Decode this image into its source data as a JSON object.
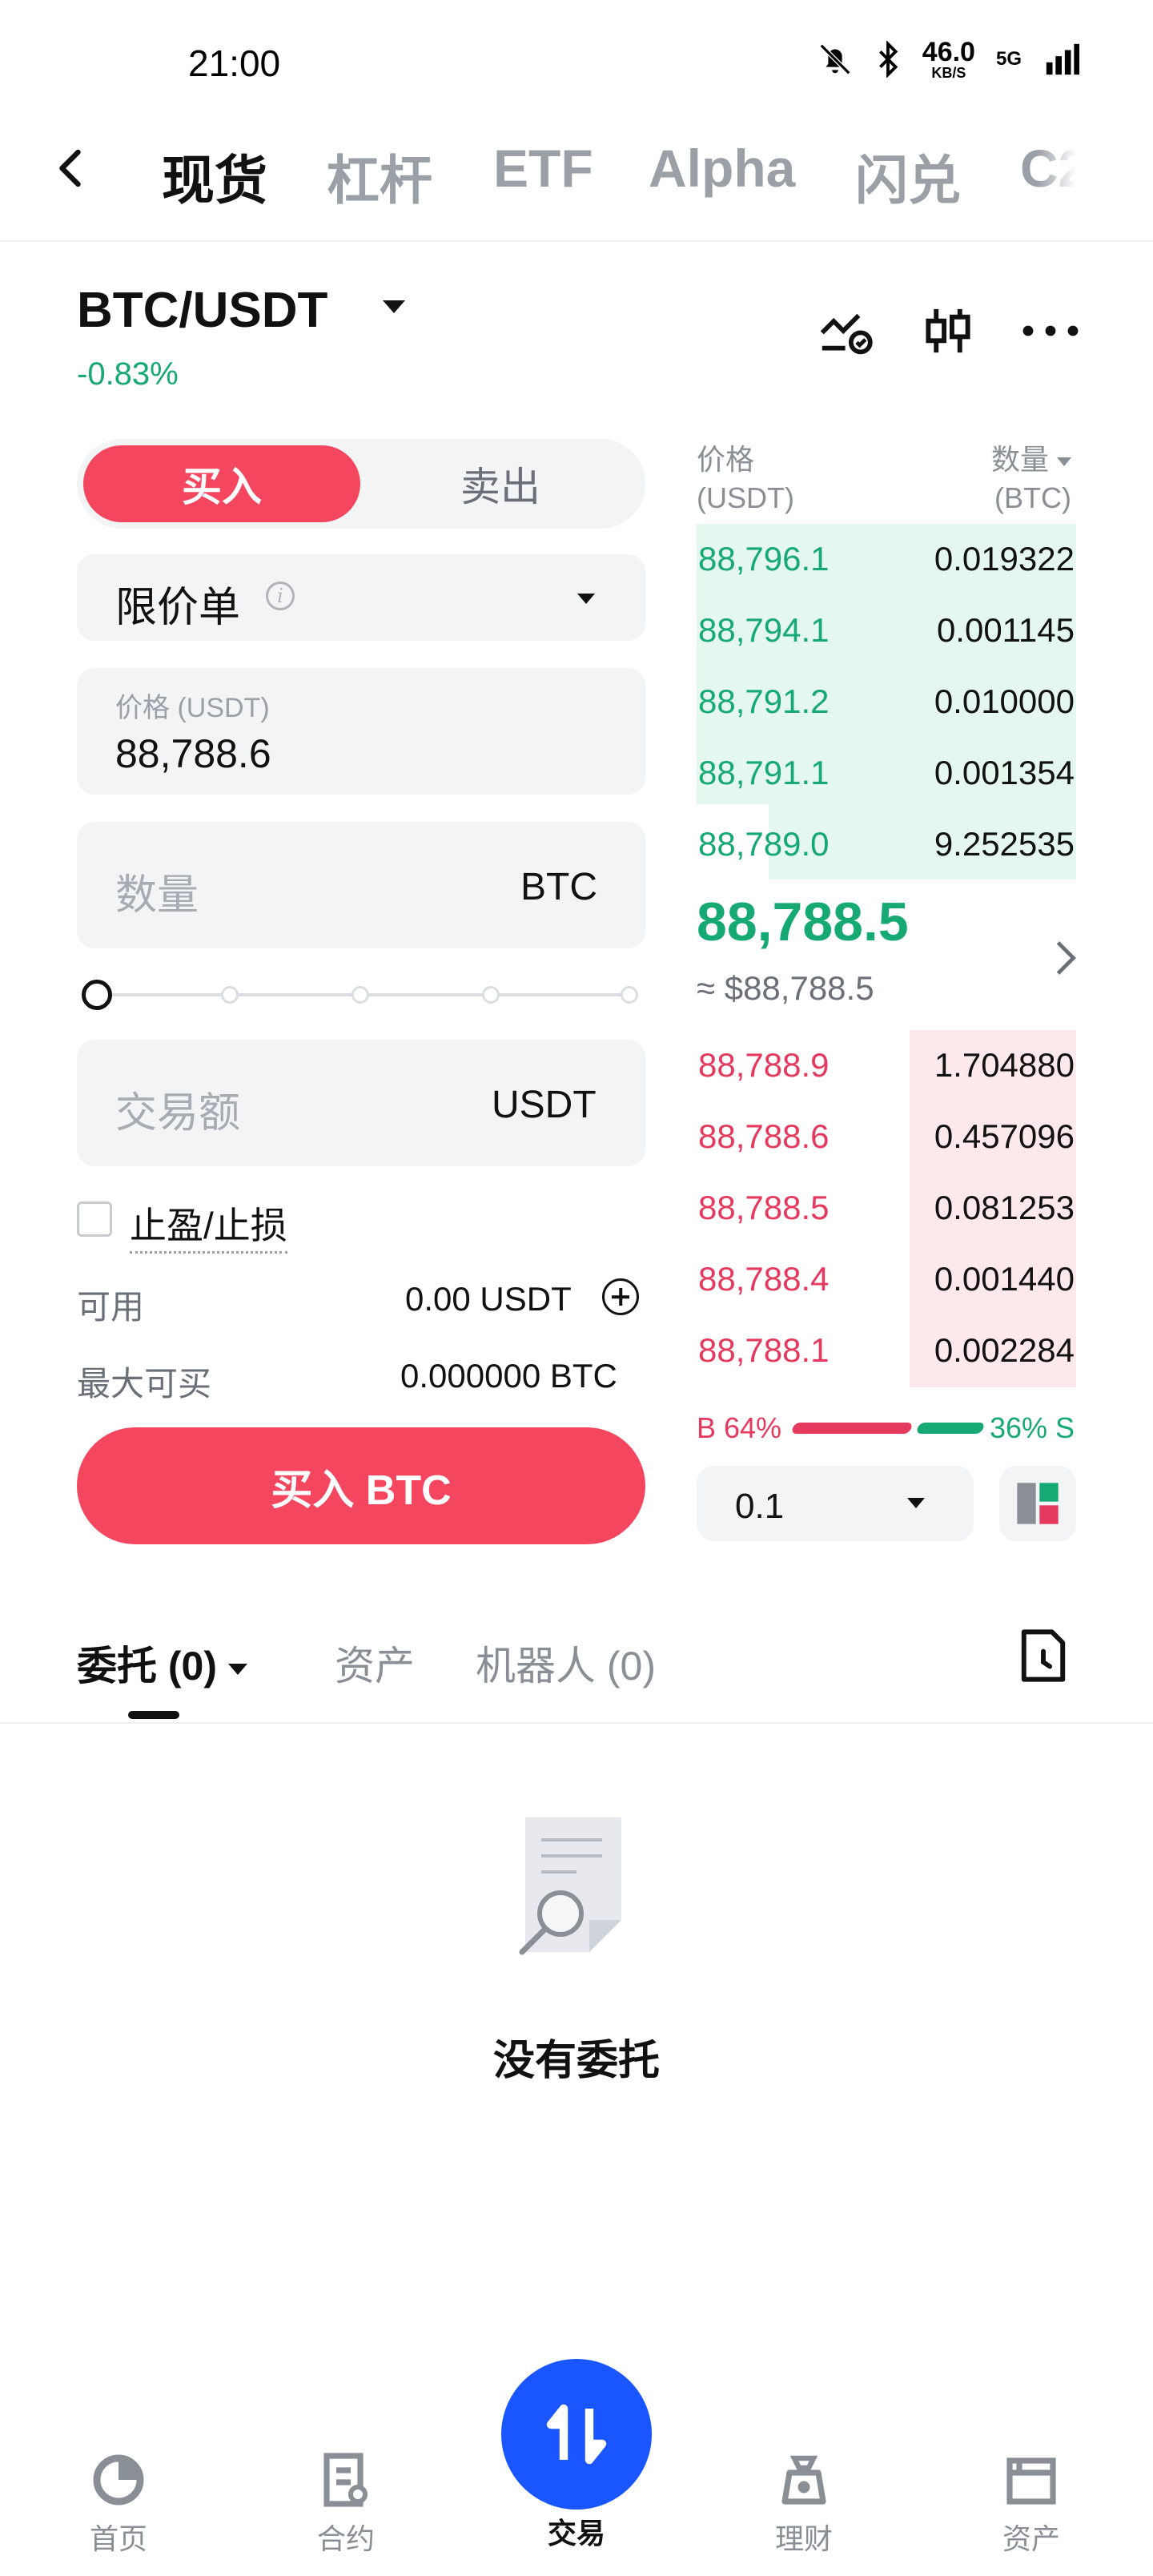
{
  "status_bar": {
    "time": "21:00",
    "speed_value": "46.0",
    "speed_unit": "KB/S",
    "network": "5G"
  },
  "top_tabs": [
    "现货",
    "杠杆",
    "ETF",
    "Alpha",
    "闪兑",
    "C2"
  ],
  "pair": {
    "symbol": "BTC/USDT",
    "change": "-0.83%"
  },
  "order_form": {
    "buy_label": "买入",
    "sell_label": "卖出",
    "order_type": "限价单",
    "info_glyph": "i",
    "price_label": "价格 (USDT)",
    "price_value": "88,788.6",
    "qty_placeholder": "数量",
    "qty_unit": "BTC",
    "amount_placeholder": "交易额",
    "amount_unit": "USDT",
    "tpsl_label": "止盈/止损",
    "available_label": "可用",
    "available_value": "0.00 USDT",
    "max_buy_label": "最大可买",
    "max_buy_value": "0.000000 BTC",
    "submit_label": "买入 BTC"
  },
  "order_book": {
    "price_header": "价格",
    "price_header_unit": "(USDT)",
    "qty_header": "数量",
    "qty_header_unit": "(BTC)",
    "asks": [
      {
        "price": "88,796.1",
        "qty": "0.019322"
      },
      {
        "price": "88,794.1",
        "qty": "0.001145"
      },
      {
        "price": "88,791.2",
        "qty": "0.010000"
      },
      {
        "price": "88,791.1",
        "qty": "0.001354"
      },
      {
        "price": "88,789.0",
        "qty": "9.252535"
      }
    ],
    "last_price": "88,788.5",
    "last_price_usd": "≈ $88,788.5",
    "bids": [
      {
        "price": "88,788.9",
        "qty": "1.704880"
      },
      {
        "price": "88,788.6",
        "qty": "0.457096"
      },
      {
        "price": "88,788.5",
        "qty": "0.081253"
      },
      {
        "price": "88,788.4",
        "qty": "0.001440"
      },
      {
        "price": "88,788.1",
        "qty": "0.002284"
      }
    ],
    "buy_ratio": "B 64%",
    "sell_ratio": "36% S",
    "buy_ratio_value": 64,
    "sell_ratio_value": 36,
    "depth_value": "0.1"
  },
  "bottom_tabs": {
    "orders": "委托 (0)",
    "assets": "资产",
    "bots": "机器人 (0)"
  },
  "empty_state": "没有委托",
  "nav": {
    "home": "首页",
    "futures": "合约",
    "trade": "交易",
    "earn": "理财",
    "assets": "资产"
  },
  "colors": {
    "green": "#17a974",
    "red": "#e5395d",
    "buy_button": "#f4475f",
    "fab": "#1a56ff"
  },
  "icons": [
    "back-arrow-icon",
    "chart-alert-icon",
    "candlestick-icon",
    "more-icon",
    "history-icon",
    "empty-search-doc-icon",
    "home-icon",
    "futures-icon",
    "trade-icon",
    "earn-icon",
    "assets-icon"
  ]
}
